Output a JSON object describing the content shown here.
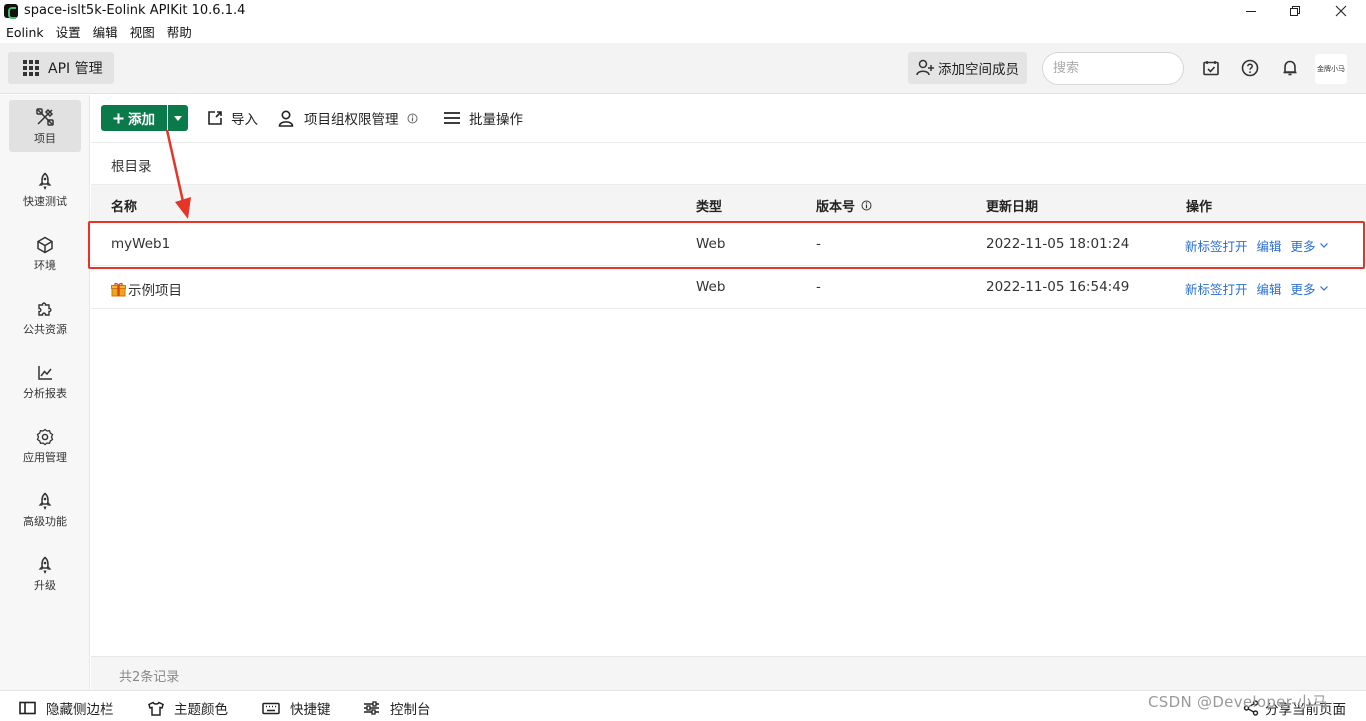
{
  "window": {
    "title": "space-islt5k-Eolink APIKit 10.6.1.4",
    "icon": "app-logo-icon"
  },
  "menubar": [
    "Eolink",
    "设置",
    "编辑",
    "视图",
    "帮助"
  ],
  "header": {
    "module_label": "API 管理",
    "invite_label": "添加空间成员",
    "search_placeholder": "搜索",
    "avatar_text": "金牌小马"
  },
  "sidebar": {
    "items": [
      {
        "label": "项目",
        "icon": "project-icon",
        "active": true
      },
      {
        "label": "快速测试",
        "icon": "rocket-icon"
      },
      {
        "label": "环境",
        "icon": "cube-icon"
      },
      {
        "label": "公共资源",
        "icon": "puzzle-icon"
      },
      {
        "label": "分析报表",
        "icon": "chart-icon"
      },
      {
        "label": "应用管理",
        "icon": "gear-icon"
      },
      {
        "label": "高级功能",
        "icon": "rocket-icon"
      },
      {
        "label": "升级",
        "icon": "rocket-icon"
      }
    ]
  },
  "toolbar": {
    "add_label": "添加",
    "import_label": "导入",
    "permission_label": "项目组权限管理",
    "batch_label": "批量操作"
  },
  "breadcrumb": "根目录",
  "table": {
    "columns": {
      "name": "名称",
      "type": "类型",
      "version": "版本号",
      "updated": "更新日期",
      "actions": "操作"
    },
    "rows": [
      {
        "name": "myWeb1",
        "type": "Web",
        "version": "-",
        "updated": "2022-11-05 18:01:24",
        "highlighted": true
      },
      {
        "name": "示例项目",
        "type": "Web",
        "version": "-",
        "updated": "2022-11-05 16:54:49",
        "icon": "gift-icon"
      }
    ],
    "actions": {
      "open": "新标签打开",
      "edit": "编辑",
      "more": "更多"
    }
  },
  "footer": {
    "count_text": "共2条记录"
  },
  "statusbar": {
    "hide_sidebar": "隐藏侧边栏",
    "theme_color": "主题颜色",
    "shortcuts": "快捷键",
    "console": "控制台",
    "share": "分享当前页面",
    "watermark": "CSDN @Developer-小马"
  },
  "colors": {
    "primary": "#0b7a4b",
    "link": "#2a6fd6",
    "annotation": "#e53528"
  }
}
